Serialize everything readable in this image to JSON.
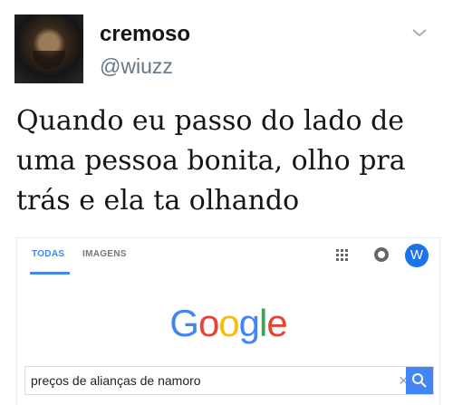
{
  "tweet": {
    "display_name": "cremoso",
    "handle": "@wiuzz",
    "text_lines": [
      "Quando eu passo do lado de",
      "uma pessoa bonita, olho pra",
      "trás e ela ta olhando"
    ],
    "menu_icon": "chevron-down-icon"
  },
  "embedded_screenshot": {
    "tabs": [
      {
        "label": "TODAS",
        "active": true
      },
      {
        "label": "IMAGENS",
        "active": false
      }
    ],
    "icons": [
      "apps-grid-icon",
      "notifications-icon"
    ],
    "account_initial": "W",
    "logo": [
      "G",
      "o",
      "o",
      "g",
      "l",
      "e"
    ],
    "logo_colors": [
      "#4285f4",
      "#ea4335",
      "#fbbc05",
      "#4285f4",
      "#34a853",
      "#ea4335"
    ],
    "search": {
      "value": "preços de alianças de namoro",
      "clear_icon": "close-icon",
      "button_icon": "search-icon"
    }
  }
}
